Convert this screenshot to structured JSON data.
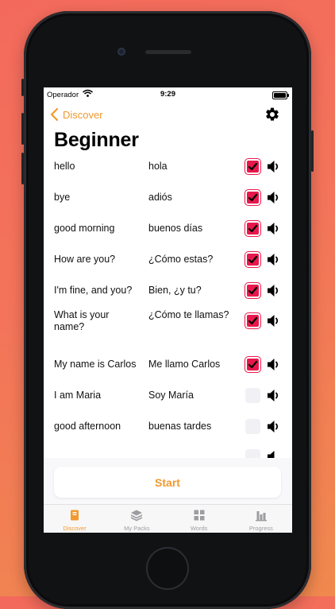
{
  "status_bar": {
    "carrier": "Operador",
    "time": "9:29"
  },
  "nav": {
    "back_label": "Discover"
  },
  "page": {
    "title": "Beginner"
  },
  "colors": {
    "accent": "#f2992e",
    "check_on": "#e8184c",
    "check_off": "#f1f1f5"
  },
  "words": [
    {
      "english": "hello",
      "spanish": "hola",
      "checked": true
    },
    {
      "english": "bye",
      "spanish": "adiós",
      "checked": true
    },
    {
      "english": "good morning",
      "spanish": "buenos días",
      "checked": true
    },
    {
      "english": "How are you?",
      "spanish": "¿Cómo estas?",
      "checked": true
    },
    {
      "english": "I'm fine, and you?",
      "spanish": "Bien, ¿y tu?",
      "checked": true
    },
    {
      "english": "What is your name?",
      "spanish": "¿Cómo te llamas?",
      "checked": true
    },
    {
      "english": "My name is Carlos",
      "spanish": "Me llamo Carlos",
      "checked": true
    },
    {
      "english": "I am Maria",
      "spanish": "Soy María",
      "checked": false
    },
    {
      "english": "good afternoon",
      "spanish": "buenas tardes",
      "checked": false
    }
  ],
  "start_label": "Start",
  "tabs": [
    {
      "label": "Discover",
      "icon": "discover-icon",
      "active": true
    },
    {
      "label": "My Packs",
      "icon": "layers-icon",
      "active": false
    },
    {
      "label": "Words",
      "icon": "grid-icon",
      "active": false
    },
    {
      "label": "Progress",
      "icon": "bar-chart-icon",
      "active": false
    }
  ]
}
